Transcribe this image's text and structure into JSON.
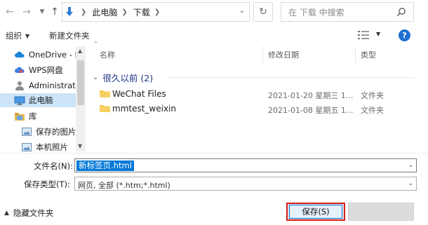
{
  "address": {
    "crumbs": [
      "此电脑",
      "下载"
    ],
    "search_placeholder": "在 下载 中搜索"
  },
  "toolbar": {
    "organize_label": "组织",
    "new_folder_label": "新建文件夹"
  },
  "nav_items": [
    {
      "label": "OneDrive - P",
      "icon": "cloud-icon"
    },
    {
      "label": "WPS网盘",
      "icon": "cloud-drive-icon"
    },
    {
      "label": "Administrato",
      "icon": "user-icon"
    },
    {
      "label": "此电脑",
      "icon": "computer-icon"
    },
    {
      "label": "库",
      "icon": "library-icon"
    },
    {
      "label": "保存的图片",
      "icon": "picture-library-icon"
    },
    {
      "label": "本机照片",
      "icon": "picture-library-icon"
    }
  ],
  "columns": {
    "name": "名称",
    "date": "修改日期",
    "type": "类型"
  },
  "group": {
    "label": "很久以前 (2)"
  },
  "files": [
    {
      "name": "WeChat Files",
      "date": "2021-01-20 星期三 1...",
      "type": "文件夹"
    },
    {
      "name": "mmtest_weixin",
      "date": "2021-01-08 星期五 1...",
      "type": "文件夹"
    }
  ],
  "form": {
    "filename_label": "文件名(N):",
    "filename_value": "新标签页.html",
    "filetype_label": "保存类型(T):",
    "filetype_value": "网页, 全部 (*.htm;*.html)",
    "hide_folders_label": "隐藏文件夹",
    "save_label": "保存(S)"
  },
  "colors": {
    "accent": "#0078d7",
    "highlight": "#d61f1f",
    "folder": "#f3c344"
  }
}
